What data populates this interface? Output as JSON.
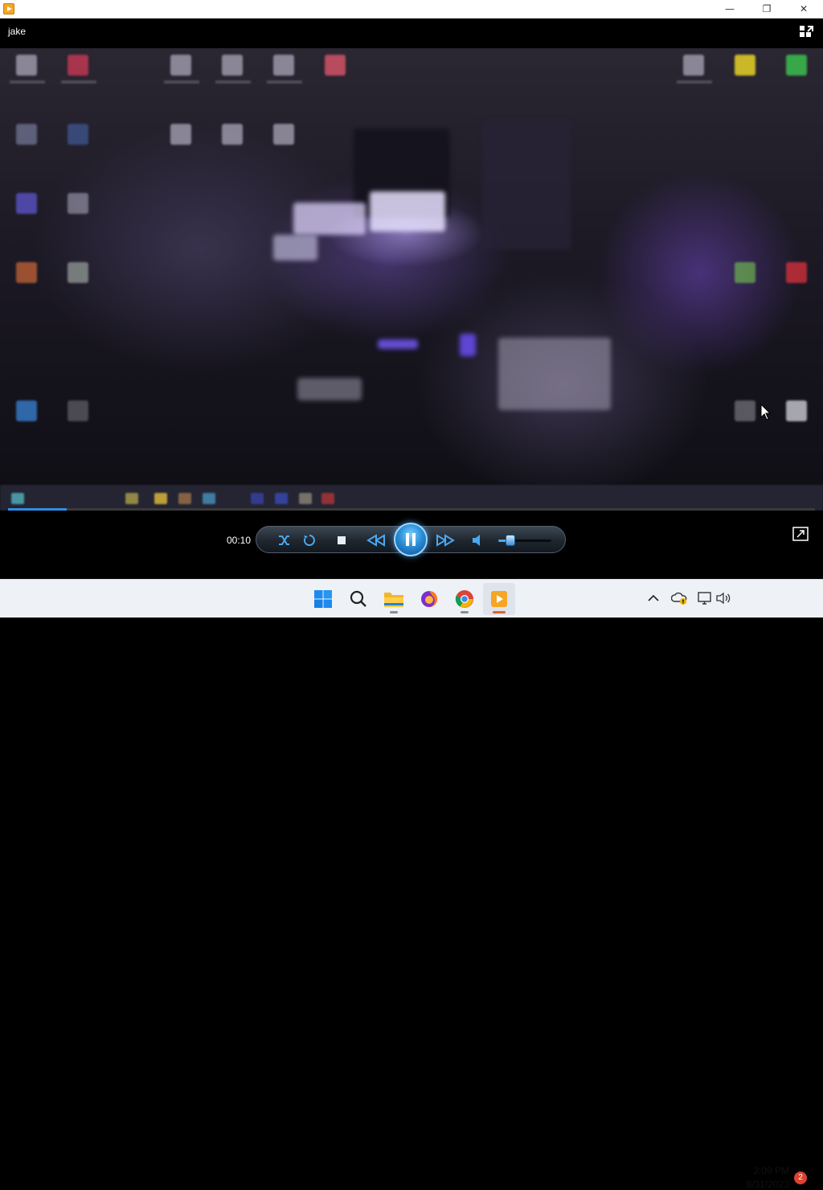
{
  "window": {
    "app_icon": "media-player-icon",
    "controls": [
      "minimize-icon",
      "restore-icon",
      "close-icon"
    ]
  },
  "player": {
    "title": "jake",
    "current_time": "00:10",
    "progress": 0.073,
    "volume": 0.22,
    "state": "playing",
    "accent": "#2e8ce6"
  },
  "controls": {
    "shuffle": "shuffle-icon",
    "repeat": "repeat-icon",
    "stop": "stop-icon",
    "previous": "previous-icon",
    "pause": "pause-icon",
    "next": "next-icon",
    "mute": "volume-icon",
    "fullscreen": "switch-to-now-playing-icon"
  },
  "taskbar": {
    "apps": [
      "windows-start-icon",
      "search-icon",
      "file-explorer-icon",
      "firefox-icon",
      "chrome-icon",
      "media-player-icon"
    ],
    "clock_time": "2:09 PM",
    "clock_date": "8/31/2023",
    "notification_count": "2"
  }
}
